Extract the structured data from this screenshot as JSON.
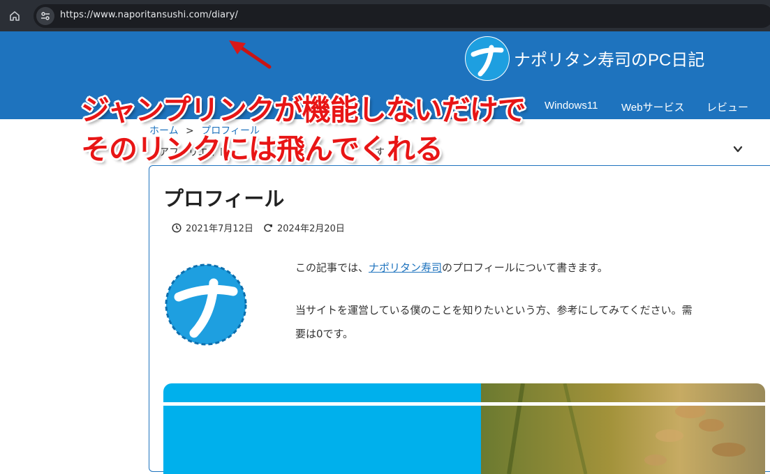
{
  "browser": {
    "url": "https://www.naporitansushi.com/diary/"
  },
  "site": {
    "title": "ナポリタン寿司のPC日記",
    "nav": [
      "Windows11",
      "Webサービス",
      "レビュー"
    ]
  },
  "callout": {
    "line1": "ジャンプリンクが機能しないだけで",
    "line2": "そのリンクには飛んでくれる"
  },
  "breadcrumb": {
    "home": "ホーム",
    "separator": ">",
    "current": "プロフィール"
  },
  "subtitle": "アフィリエイト",
  "subtitle_tail": "す",
  "article": {
    "title": "プロフィール",
    "published": "2021年7月12日",
    "updated": "2024年2月20日",
    "para1_prefix": "この記事では、",
    "para1_link": "ナポリタン寿司",
    "para1_suffix": "のプロフィールについて書きます。",
    "para2_line1": "当サイトを運営している僕のことを知りたいという方、参考にしてみてください。需",
    "para2_line2": "要は0です。"
  },
  "colors": {
    "header": "#1e73be",
    "callout": "#e81515",
    "banner": "#00b0ec"
  }
}
